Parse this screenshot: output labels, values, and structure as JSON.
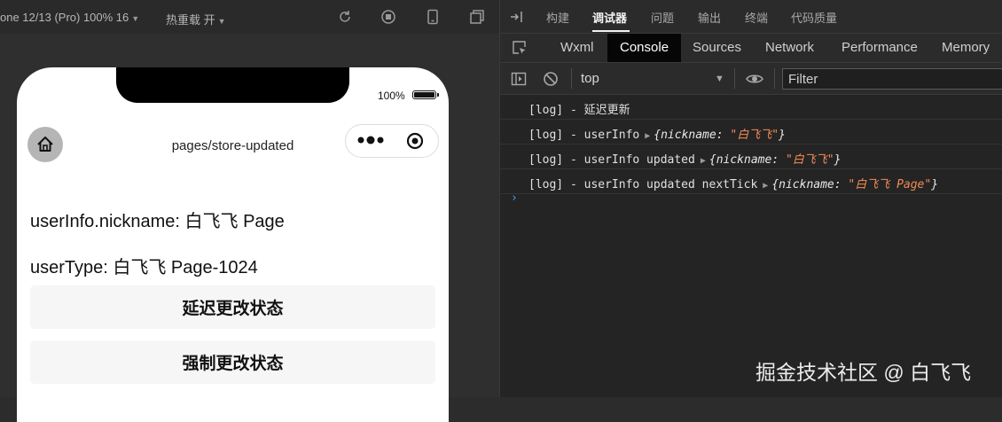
{
  "simulator": {
    "device_label": "one 12/13 (Pro) 100% 16",
    "hot_reload_label": "热重载 开",
    "status_bar": {
      "battery_text": "100%",
      "battery_level": 1.0
    },
    "nav": {
      "page_path": "pages/store-updated"
    },
    "content": {
      "nickname_line": "userInfo.nickname: 白飞飞 Page",
      "usertype_line": "userType: 白飞飞 Page-1024"
    },
    "buttons": {
      "delay_update": "延迟更改状态",
      "force_update": "强制更改状态"
    }
  },
  "devtools": {
    "top_tabs": [
      "构建",
      "调试器",
      "问题",
      "输出",
      "终端",
      "代码质量"
    ],
    "active_top_tab": "调试器",
    "panel_tabs": [
      "Wxml",
      "Console",
      "Sources",
      "Network",
      "Performance",
      "Memory"
    ],
    "active_panel_tab": "Console",
    "console": {
      "context": "top",
      "filter_placeholder": "Filter",
      "logs": [
        {
          "prefix": "[log] - 延迟更新"
        },
        {
          "prefix": "[log] - userInfo",
          "obj_key": "nickname:",
          "obj_value": "\"白飞飞\""
        },
        {
          "prefix": "[log] - userInfo updated",
          "obj_key": "nickname:",
          "obj_value": "\"白飞飞\""
        },
        {
          "prefix": "[log] - userInfo updated nextTick",
          "obj_key": "nickname:",
          "obj_value": "\"白飞飞 Page\""
        }
      ],
      "prompt": "›"
    }
  },
  "watermark": "掘金技术社区 @ 白飞飞",
  "colors": {
    "accent_prompt": "#4a9ef0",
    "string_value": "#f28b54",
    "active_tab_bg": "#060606"
  },
  "icons": [
    "refresh-icon",
    "stop-icon",
    "phone-icon",
    "window-icon",
    "dock-icon",
    "inspect-icon",
    "sidebar-toggle-icon",
    "clear-icon",
    "eye-icon",
    "home-icon",
    "more-icon",
    "close-mini-icon"
  ]
}
